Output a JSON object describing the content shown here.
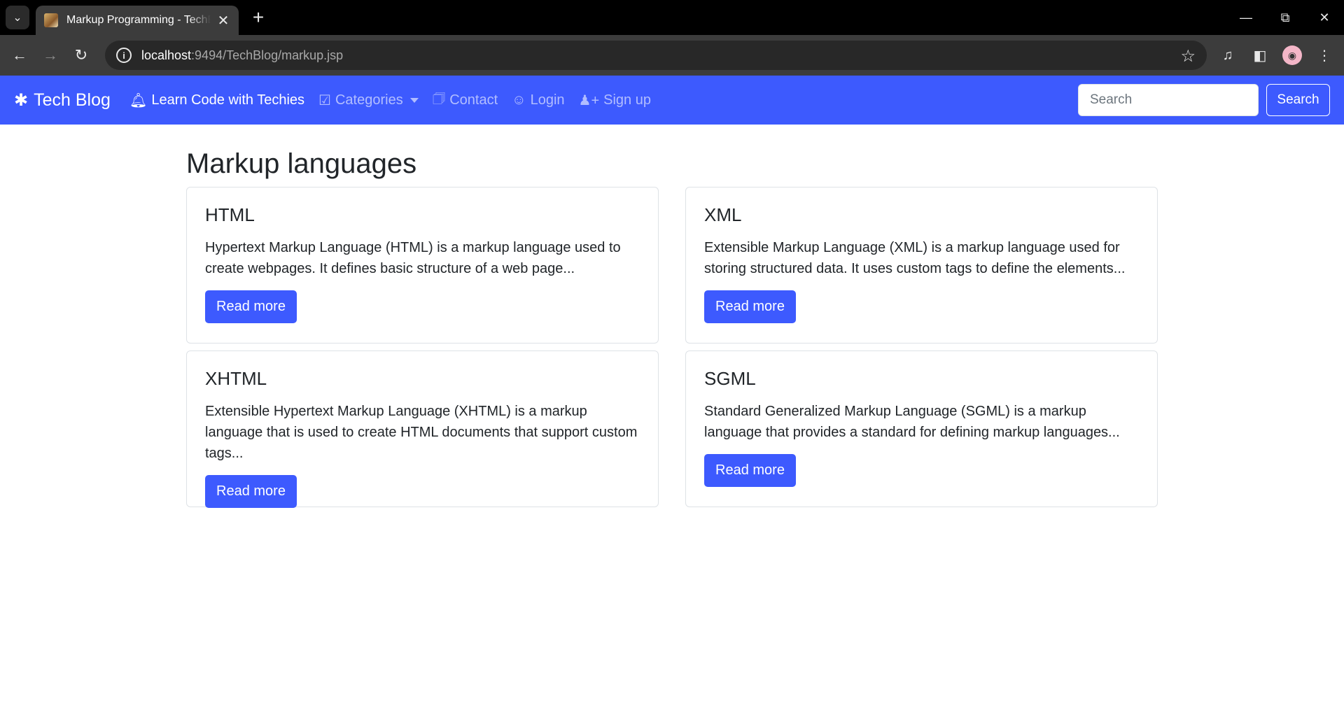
{
  "browser": {
    "tab_title": "Markup Programming - TechBlog",
    "url_host": "localhost",
    "url_rest": ":9494/TechBlog/markup.jsp"
  },
  "navbar": {
    "brand": "Tech Blog",
    "links": [
      {
        "label": "Learn Code with Techies",
        "icon": "bell-icon"
      },
      {
        "label": "Categories",
        "icon": "check-square-icon"
      },
      {
        "label": "Contact",
        "icon": "address-card-icon"
      },
      {
        "label": "Login",
        "icon": "user-circle-icon"
      },
      {
        "label": "Sign up",
        "icon": "user-plus-icon"
      }
    ],
    "search_placeholder": "Search",
    "search_button": "Search",
    "accent_color": "#3d5afe"
  },
  "page": {
    "title": "Markup languages",
    "cards": [
      {
        "title": "HTML",
        "text": "Hypertext Markup Language (HTML) is a markup language used to create webpages. It defines basic structure of a web page...",
        "button": "Read more"
      },
      {
        "title": "XML",
        "text": "Extensible Markup Language (XML) is a markup language used for storing structured data. It uses custom tags to define the elements...",
        "button": "Read more"
      },
      {
        "title": "XHTML",
        "text": "Extensible Hypertext Markup Language (XHTML) is a markup language that is used to create HTML documents that support custom tags...",
        "button": "Read more"
      },
      {
        "title": "SGML",
        "text": "Standard Generalized Markup Language (SGML) is a markup language that provides a standard for defining markup languages...",
        "button": "Read more"
      }
    ]
  }
}
